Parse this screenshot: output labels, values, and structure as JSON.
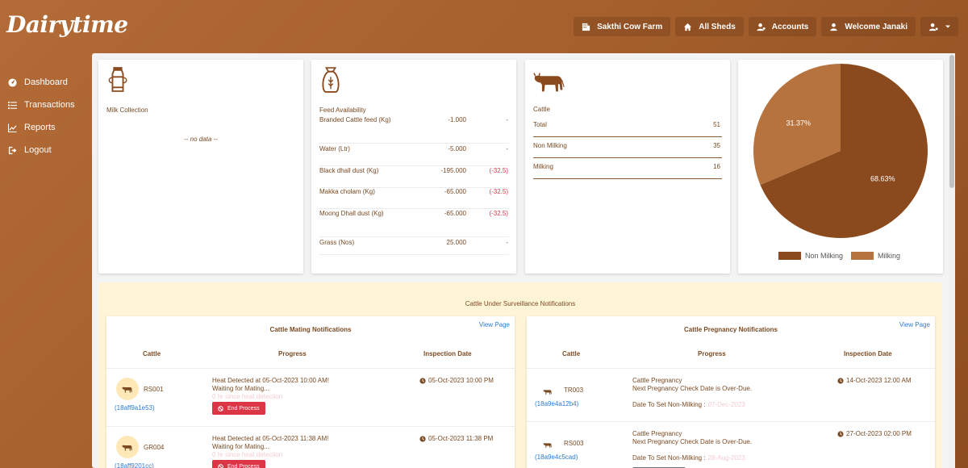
{
  "brand": "Dairytime",
  "topnav": {
    "farm": "Sakthi Cow Farm",
    "sheds": "All Sheds",
    "accounts": "Accounts",
    "welcome": "Welcome Janaki"
  },
  "sidebar": [
    {
      "label": "Dashboard",
      "icon": "dashboard-icon"
    },
    {
      "label": "Transactions",
      "icon": "list-icon"
    },
    {
      "label": "Reports",
      "icon": "chart-icon"
    },
    {
      "label": "Logout",
      "icon": "logout-icon"
    }
  ],
  "milk": {
    "title": "Milk Collection",
    "empty": "-- no data --"
  },
  "feed": {
    "title": "Feed Availability",
    "rows": [
      {
        "name": "Branded Cattle feed (Kg)",
        "value": "-1.000",
        "diff": "-"
      },
      {
        "name": "Water (Ltr)",
        "value": "-5.000",
        "diff": "-"
      },
      {
        "name": "Black dhall dust (Kg)",
        "value": "-195.000",
        "diff": "(-32.5)"
      },
      {
        "name": "Makka cholam (Kg)",
        "value": "-65.000",
        "diff": "(-32.5)"
      },
      {
        "name": "Moong Dhall dust (Kg)",
        "value": "-65.000",
        "diff": "(-32.5)"
      },
      {
        "name": "Grass (Nos)",
        "value": "25.000",
        "diff": "-"
      }
    ]
  },
  "cattle": {
    "title": "Cattle",
    "rows": [
      {
        "label": "Total",
        "value": "51"
      },
      {
        "label": "Non Milking",
        "value": "35"
      },
      {
        "label": "Milking",
        "value": "16"
      }
    ]
  },
  "chart_data": {
    "type": "pie",
    "labels": [
      "Non Milking",
      "Milking"
    ],
    "values": [
      68.63,
      31.37
    ],
    "value_labels": [
      "68.63%",
      "31.37%"
    ],
    "colors": [
      "#8b4a1e",
      "#b7733e"
    ],
    "legend": "bottom"
  },
  "surveillance": {
    "title": "Cattle Under Surveillance Notifications",
    "mating": {
      "title": "Cattle Mating Notifications",
      "view": "View Page",
      "headers": [
        "Cattle",
        "Progress",
        "Inspection Date"
      ],
      "rows": [
        {
          "id": "RS001",
          "code": "(18aff9a1e53)",
          "line1": "Heat Detected at 05-Oct-2023 10:00 AM!",
          "line2": "Waiting for Mating...",
          "faint": "0 hr since heat detection",
          "button": "End Process",
          "date": "05-Oct-2023 10:00 PM"
        },
        {
          "id": "GR004",
          "code": "(18aff9201cc)",
          "line1": "Heat Detected at 05-Oct-2023 11:38 AM!",
          "line2": "Waiting for Mating...",
          "faint": "0 hr since heat detection",
          "button": "End Process",
          "date": "05-Oct-2023 11:38 PM"
        }
      ]
    },
    "pregnancy": {
      "title": "Cattle Pregnancy Notifications",
      "view": "View Page",
      "headers": [
        "Cattle",
        "Progress",
        "Inspection Date"
      ],
      "rows": [
        {
          "id": "TR003",
          "code": "(18a9e4a12b4)",
          "line1": "Cattle Pregnancy",
          "line2": "Next Pregnancy Check Date is Over-Due.",
          "faint": "",
          "nonmilk_label": "Date To Set Non-Milking :",
          "nonmilk_date": "07-Dec-2023",
          "date": "14-Oct-2023 12:00 AM"
        },
        {
          "id": "RS003",
          "code": "(18a9e4c5cad)",
          "line1": "Cattle Pregnancy",
          "line2": "Next Pregnancy Check Date is Over-Due.",
          "faint": "",
          "nonmilk_label": "Date To Set Non-Milking :",
          "nonmilk_date": "28-Aug-2023",
          "date": "27-Oct-2023 02:00 PM"
        }
      ]
    }
  }
}
